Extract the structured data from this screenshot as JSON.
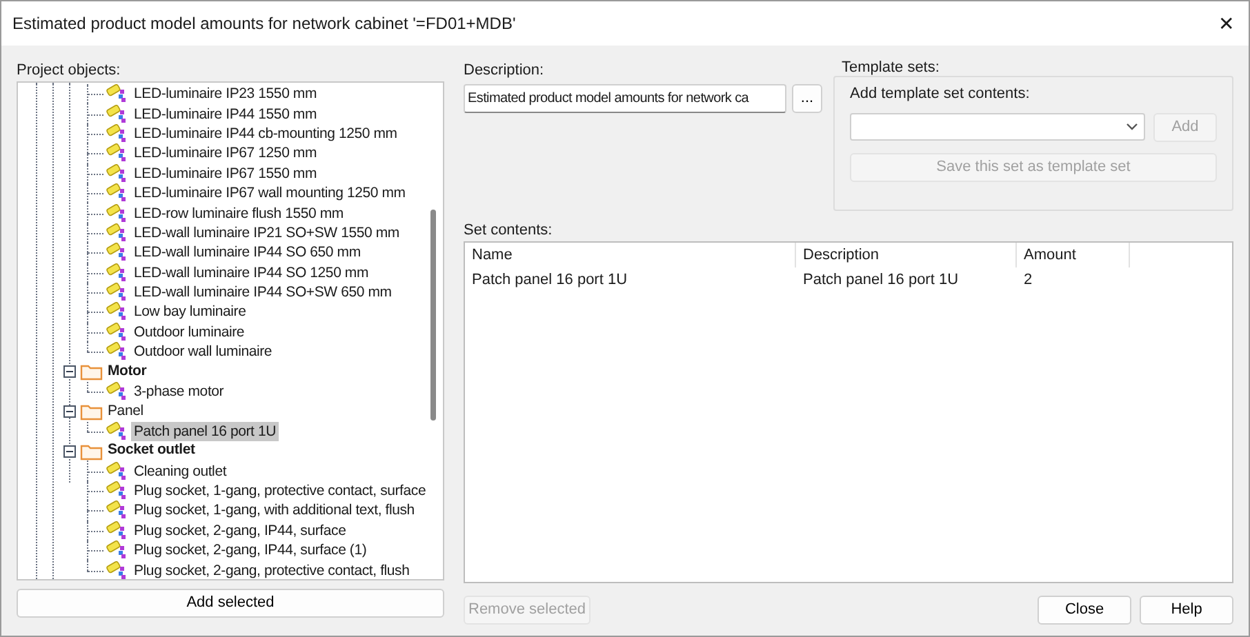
{
  "window": {
    "title": "Estimated product model amounts for network cabinet '=FD01+MDB'",
    "close": "✕"
  },
  "project_objects": {
    "label": "Project objects:",
    "tree": [
      {
        "kind": "continued",
        "children": [
          {
            "label": "LED-luminaire IP23 1550 mm",
            "selected": false
          },
          {
            "label": "LED-luminaire IP44 1550 mm",
            "selected": false
          },
          {
            "label": "LED-luminaire IP44 cb-mounting 1250 mm",
            "selected": false
          },
          {
            "label": "LED-luminaire IP67 1250 mm",
            "selected": false
          },
          {
            "label": "LED-luminaire IP67 1550 mm",
            "selected": false
          },
          {
            "label": "LED-luminaire IP67 wall mounting 1250 mm",
            "selected": false
          },
          {
            "label": "LED-row luminaire flush 1550 mm",
            "selected": false
          },
          {
            "label": "LED-wall luminaire IP21 SO+SW 1550 mm",
            "selected": false
          },
          {
            "label": "LED-wall luminaire IP44 SO 650 mm",
            "selected": false
          },
          {
            "label": "LED-wall luminaire IP44 SO 1250 mm",
            "selected": false
          },
          {
            "label": "LED-wall luminaire IP44 SO+SW 650 mm",
            "selected": false
          },
          {
            "label": "Low bay luminaire",
            "selected": false
          },
          {
            "label": "Outdoor luminaire",
            "selected": false
          },
          {
            "label": "Outdoor wall luminaire",
            "selected": false
          }
        ]
      },
      {
        "kind": "folder",
        "label": "Motor",
        "bold": true,
        "expanded": true,
        "children": [
          {
            "label": "3-phase motor",
            "selected": false
          }
        ]
      },
      {
        "kind": "folder",
        "label": "Panel",
        "bold": false,
        "expanded": true,
        "children": [
          {
            "label": "Patch panel 16 port 1U",
            "selected": true
          }
        ]
      },
      {
        "kind": "folder",
        "label": "Socket outlet",
        "bold": true,
        "expanded": true,
        "children": [
          {
            "label": "Cleaning outlet",
            "selected": false
          },
          {
            "label": "Plug socket, 1-gang, protective contact, surface",
            "selected": false
          },
          {
            "label": "Plug socket, 1-gang, with additional text, flush",
            "selected": false
          },
          {
            "label": "Plug socket, 2-gang, IP44, surface",
            "selected": false
          },
          {
            "label": "Plug socket, 2-gang, IP44, surface (1)",
            "selected": false
          },
          {
            "label": "Plug socket, 2-gang, protective contact, flush",
            "selected": false
          }
        ]
      }
    ],
    "add_button": "Add selected"
  },
  "description": {
    "label": "Description:",
    "value": "Estimated product model amounts for network ca",
    "browse_button": "..."
  },
  "template_sets": {
    "label": "Template sets:",
    "add_label": "Add template set contents:",
    "add_button": {
      "label": "Add",
      "disabled": true
    },
    "save_button": {
      "label": "Save this set as template set",
      "disabled": true
    }
  },
  "set_contents": {
    "label": "Set contents:",
    "columns": [
      "Name",
      "Description",
      "Amount"
    ],
    "rows": [
      [
        "Patch panel 16 port 1U",
        "Patch panel 16 port 1U",
        "2"
      ]
    ],
    "remove_button": {
      "label": "Remove selected",
      "disabled": true
    }
  },
  "buttons": [
    "Close",
    "Help"
  ]
}
